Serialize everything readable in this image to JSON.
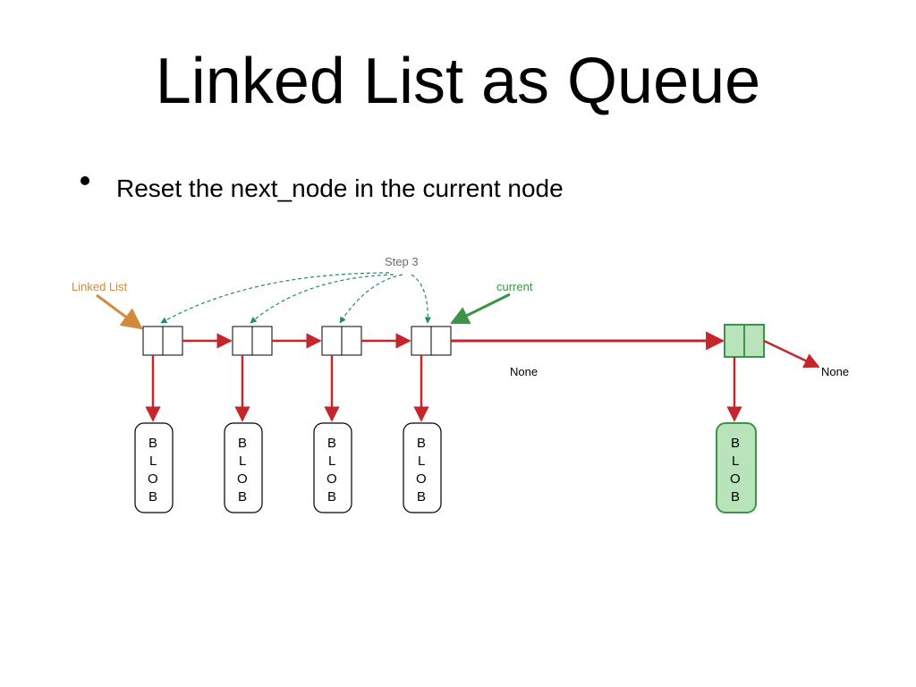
{
  "title": "Linked List as Queue",
  "bullet": "Reset the next_node in the current node",
  "step": "Step 3",
  "labels": {
    "linked_list": "Linked List",
    "current": "current",
    "none1": "None",
    "none2": "None"
  },
  "blob": {
    "b": "B",
    "l": "L",
    "o": "O",
    "b2": "B"
  },
  "colors": {
    "orange": "#d18a3b",
    "red": "#c4262c",
    "green_stroke": "#3d9448",
    "green_fill": "#b9e3bb",
    "teal": "#1f8a70",
    "grey": "#6b6b6b"
  }
}
